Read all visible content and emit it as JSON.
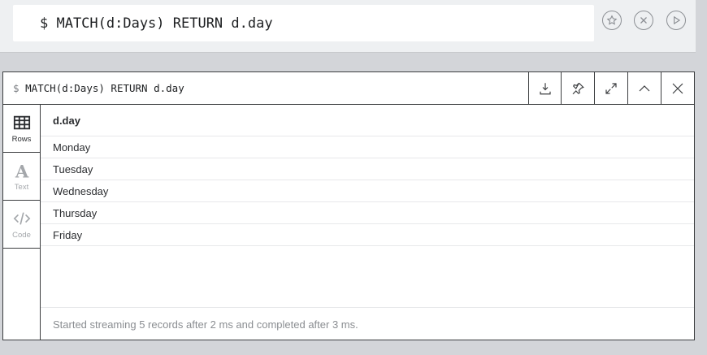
{
  "editor": {
    "query": "$ MATCH(d:Days) RETURN d.day",
    "buttons": [
      {
        "icon": "star-icon"
      },
      {
        "icon": "clear-icon"
      },
      {
        "icon": "run-icon"
      }
    ]
  },
  "frame": {
    "dollar": "$",
    "query": "MATCH(d:Days) RETURN d.day",
    "header_buttons": [
      "download-icon",
      "pin-icon",
      "expand-icon",
      "collapse-icon",
      "close-icon"
    ],
    "views": [
      {
        "label": "Rows",
        "icon": "table-icon",
        "active": true
      },
      {
        "label": "Text",
        "icon": "text-icon",
        "active": false
      },
      {
        "label": "Code",
        "icon": "code-icon",
        "active": false
      }
    ],
    "table": {
      "column": "d.day",
      "rows": [
        "Monday",
        "Tuesday",
        "Wednesday",
        "Thursday",
        "Friday"
      ]
    },
    "status": "Started streaming 5 records after 2 ms and completed after 3 ms."
  }
}
